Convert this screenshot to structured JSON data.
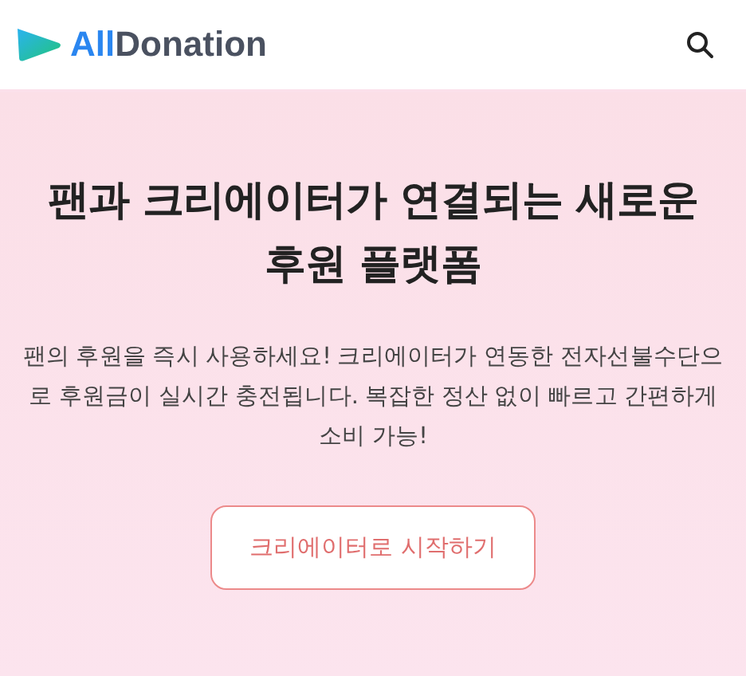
{
  "header": {
    "logo": {
      "accent": "All",
      "rest": "Donation"
    }
  },
  "hero": {
    "title": "팬과 크리에이터가 연결되는 새로운 후원 플랫폼",
    "description": "팬의 후원을 즉시 사용하세요! 크리에이터가 연동한 전자선불수단으로 후원금이 실시간 충전됩니다. 복잡한 정산 없이 빠르고 간편하게 소비 가능!",
    "button": "크리에이터로 시작하기"
  }
}
